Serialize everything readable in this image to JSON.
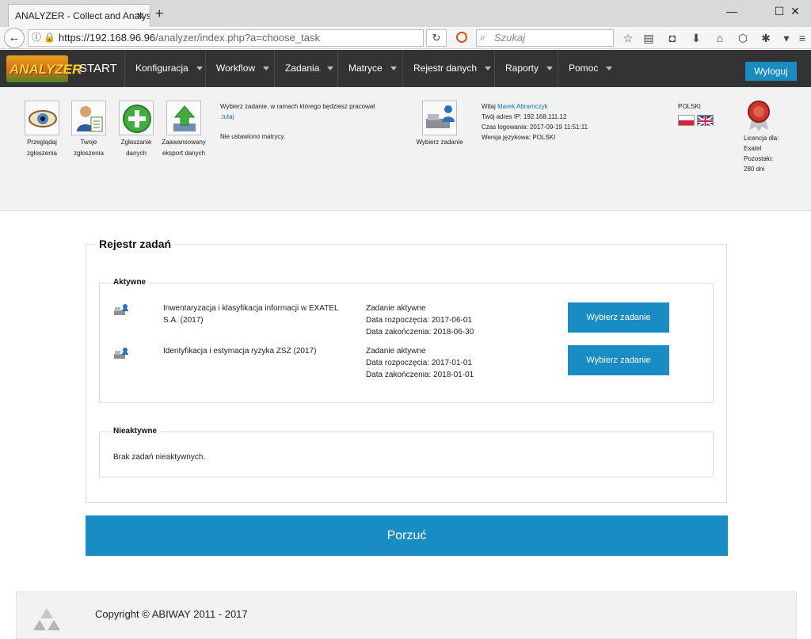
{
  "browser": {
    "tab_title": "ANALYZER - Collect and Analysi",
    "url_host": "https://192.168.96.96",
    "url_path": "/analyzer/index.php?a=choose_task",
    "search_placeholder": "Szukaj"
  },
  "app": {
    "logo_text": "ANALYZER",
    "start_label": "START",
    "menu": [
      "Konfiguracja",
      "Workflow",
      "Zadania",
      "Matryce",
      "Rejestr danych",
      "Raporty",
      "Pomoc"
    ],
    "logout_label": "Wyloguj"
  },
  "toolbar": {
    "tools": [
      {
        "label": "Przeglądaj zgłoszenia"
      },
      {
        "label": "Twoje zgłoszenia"
      },
      {
        "label": "Zgłaszanie danych"
      },
      {
        "label": "Zaawansowany eksport danych"
      }
    ],
    "choose_text": "Wybierz zadanie, w ramach którego będziesz pracował",
    "choose_link": ".tutaj",
    "no_matrix": "Nie ustawiono matrycy.",
    "choose_task_label": "Wybierz zadanie",
    "welcome_prefix": "Witaj",
    "user_name": "Marek Abramczyk",
    "ip_line": "Twój adres IP: 192.168.111.12",
    "login_time": "Czas logowania: 2017-09-19 11:51:11",
    "lang_version": "Wersja językowa: POLSKI",
    "language": "POLSKI",
    "license_for": "Licencja dla:",
    "license_company": "Exatel",
    "remaining_label": "Pozostało:",
    "remaining_days": "280 dni"
  },
  "registry": {
    "title": "Rejestr zadań",
    "active_legend": "Aktywne",
    "active_tasks": [
      {
        "name": "Inwentaryzacja i klasyfikacja informacji w EXATEL S.A. (2017)",
        "status": "Zadanie aktywne",
        "start": "Data rozpoczęcia: 2017-06-01",
        "end": "Data zakończenia: 2018-06-30",
        "button": "Wybierz zadanie"
      },
      {
        "name": "Identyfikacja i estymacja ryzyka ZSZ (2017)",
        "status": "Zadanie aktywne",
        "start": "Data rozpoczęcia: 2017-01-01",
        "end": "Data zakończenia: 2018-01-01",
        "button": "Wybierz zadanie"
      }
    ],
    "inactive_legend": "Nieaktywne",
    "inactive_empty": "Brak zadań nieaktywnych.",
    "abandon_label": "Porzuć"
  },
  "footer": {
    "copyright": "Copyright © ABIWAY 2011 - 2017"
  },
  "colors": {
    "accent": "#1a8cc4",
    "header_bg": "#333333",
    "panel_bg": "#f2f2f2"
  }
}
